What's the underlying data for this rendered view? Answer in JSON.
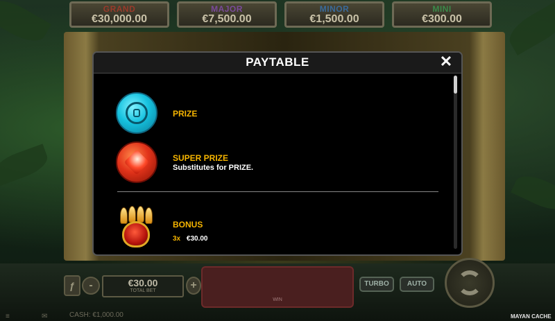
{
  "game": {
    "brand": "MAYAN CACHE",
    "jackpots": [
      {
        "name": "GRAND",
        "value": "€30,000.00",
        "color": "#c0392b"
      },
      {
        "name": "MAJOR",
        "value": "€7,500.00",
        "color": "#8e44ad"
      },
      {
        "name": "MINOR",
        "value": "€1,500.00",
        "color": "#2980b9"
      },
      {
        "name": "MINI",
        "value": "€300.00",
        "color": "#27ae60"
      }
    ],
    "bet": {
      "value": "€30.00",
      "label": "TOTAL BET",
      "minus": "-",
      "plus": "+"
    },
    "spin_area_label": "WIN",
    "turbo_label": "TURBO",
    "auto_label": "AUTO",
    "cash_text": "CASH: €1,000.00"
  },
  "paytable": {
    "title": "PAYTABLE",
    "close_icon": "✕",
    "symbols": [
      {
        "icon": "prize-coin-icon",
        "label": "PRIZE",
        "description": ""
      },
      {
        "icon": "super-prize-coin-icon",
        "label": "SUPER PRIZE",
        "description": "Substitutes for PRIZE."
      },
      {
        "icon": "bonus-paw-icon",
        "label": "BONUS",
        "payouts": [
          {
            "count": "3x",
            "amount": "€30.00"
          }
        ]
      }
    ],
    "accent_color": "#f5b400"
  }
}
